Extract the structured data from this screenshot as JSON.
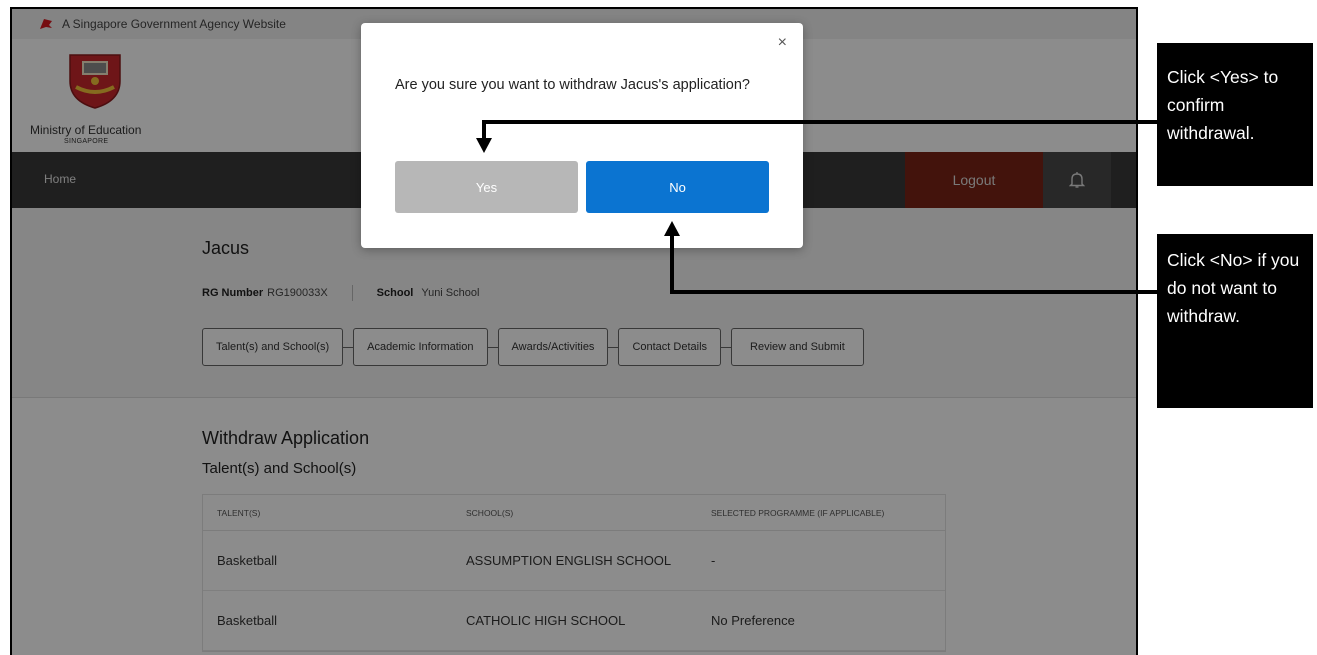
{
  "gov_banner": {
    "text": "A Singapore Government Agency Website"
  },
  "agency": {
    "name": "Ministry of Education",
    "sub": "SINGAPORE"
  },
  "nav": {
    "home": "Home",
    "logout": "Logout"
  },
  "student": {
    "name": "Jacus",
    "rg_label": "RG Number",
    "rg_value": "RG190033X",
    "school_label": "School",
    "school_value": "Yuni School"
  },
  "steps": [
    {
      "label": "Talent(s) and School(s)"
    },
    {
      "label": "Academic Information"
    },
    {
      "label": "Awards/Activities"
    },
    {
      "label": "Contact Details"
    },
    {
      "label": "Review and Submit"
    }
  ],
  "withdraw": {
    "title": "Withdraw Application",
    "subtitle": "Talent(s) and School(s)",
    "columns": [
      "TALENT(S)",
      "SCHOOL(S)",
      "SELECTED PROGRAMME (If applicable)"
    ],
    "rows": [
      [
        "Basketball",
        "ASSUMPTION ENGLISH SCHOOL",
        "-"
      ],
      [
        "Basketball",
        "CATHOLIC HIGH SCHOOL",
        "No Preference"
      ]
    ]
  },
  "modal": {
    "close": "×",
    "message": "Are you sure you want to withdraw Jacus's application?",
    "yes_label": "Yes",
    "no_label": "No"
  },
  "callouts": {
    "yes_text": "Click <Yes> to confirm withdrawal.",
    "no_text": "Click <No> if you do not want to withdraw."
  },
  "colors": {
    "logout_bg": "#7b2416",
    "no_button": "#0b74d1",
    "yes_button": "#b7b7b7",
    "navbar": "#3a3a3a"
  }
}
